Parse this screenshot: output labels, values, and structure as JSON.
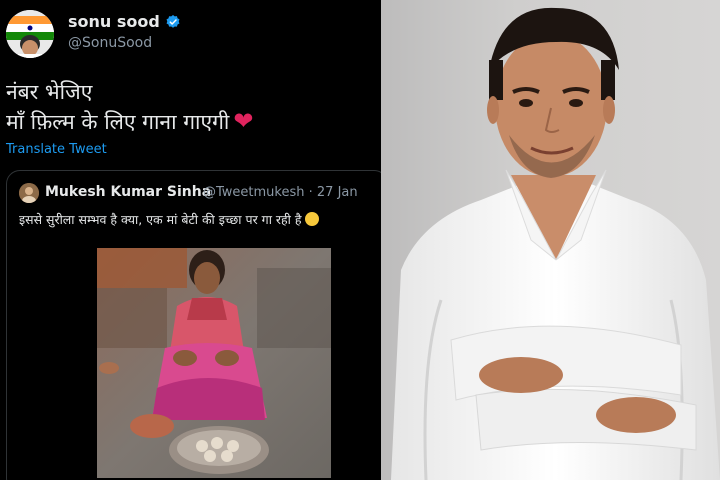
{
  "tweet": {
    "author_name": "sonu sood",
    "author_handle": "@SonuSood",
    "text_line1": "नंबर भेजिए",
    "text_line2": "माँ फ़िल्म के लिए गाना गाएगी",
    "heart": "❤",
    "translate_label": "Translate Tweet",
    "icons": [
      "verified-badge-icon",
      "heart-emoji-icon"
    ],
    "colors": {
      "background": "#000000",
      "text": "#e7e9ea",
      "secondary": "#8b98a5",
      "link": "#1d9bf0",
      "verified": "#1d9bf0",
      "heart": "#e0245e"
    }
  },
  "quote": {
    "author_name": "Mukesh Kumar Sinha",
    "author_handle": "@Tweetmukesh · 27 Jan",
    "text": "इससे सुरीला सम्भव है क्या, एक मां बेटी की इच्छा पर गा रही है",
    "emoji": "smiling-face-emoji",
    "media_description": "video-thumbnail"
  },
  "photo": {
    "subject": "man-in-white-shirt-arms-crossed"
  }
}
